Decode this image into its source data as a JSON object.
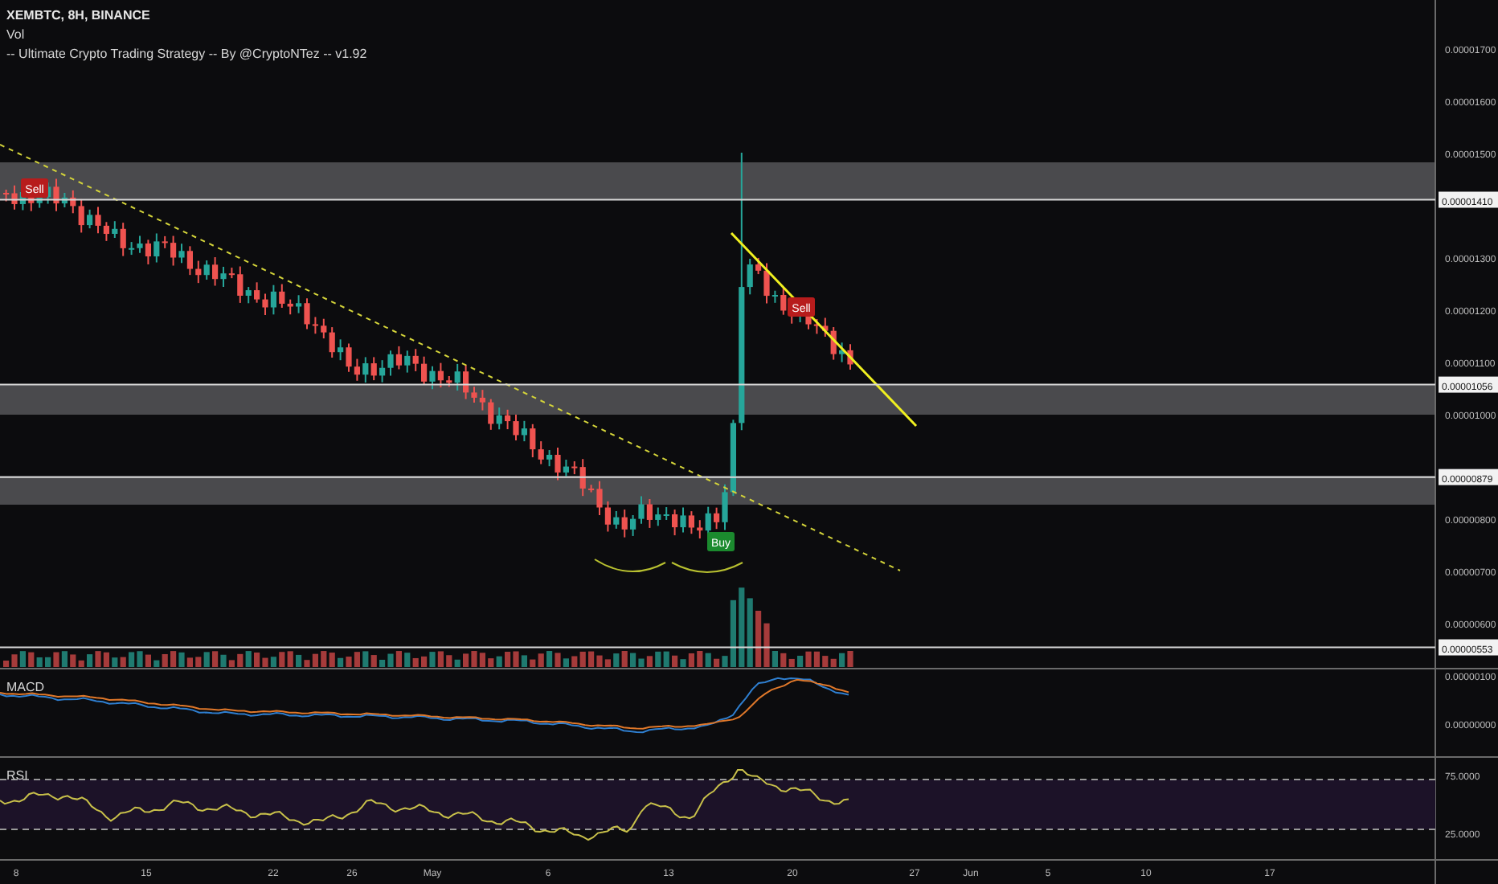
{
  "header": {
    "symbol_line": "XEMBTC, 8H, BINANCE",
    "volume_label": "Vol",
    "strategy_label": "-- Ultimate Crypto Trading Strategy -- By @CryptoNTez -- v1.92"
  },
  "price_axis": {
    "ticks": [
      "0.00001700",
      "0.00001600",
      "0.00001500",
      "0.00001300",
      "0.00001200",
      "0.00001100",
      "0.00001000",
      "0.00000800",
      "0.00000700",
      "0.00000600"
    ],
    "tags": [
      "0.00001410",
      "0.00001056",
      "0.00000879",
      "0.00000553"
    ]
  },
  "signals": [
    {
      "kind": "sell",
      "label": "Sell"
    },
    {
      "kind": "sell",
      "label": "Sell"
    },
    {
      "kind": "buy",
      "label": "Buy"
    }
  ],
  "macd": {
    "label": "MACD",
    "ticks": [
      "0.00000100",
      "0.00000000"
    ]
  },
  "rsi": {
    "label": "RSI",
    "ticks": [
      "75.0000",
      "25.0000"
    ]
  },
  "time_axis": {
    "labels": [
      "8",
      "15",
      "22",
      "26",
      "May",
      "6",
      "13",
      "20",
      "27",
      "Jun",
      "5",
      "10",
      "17"
    ]
  }
}
